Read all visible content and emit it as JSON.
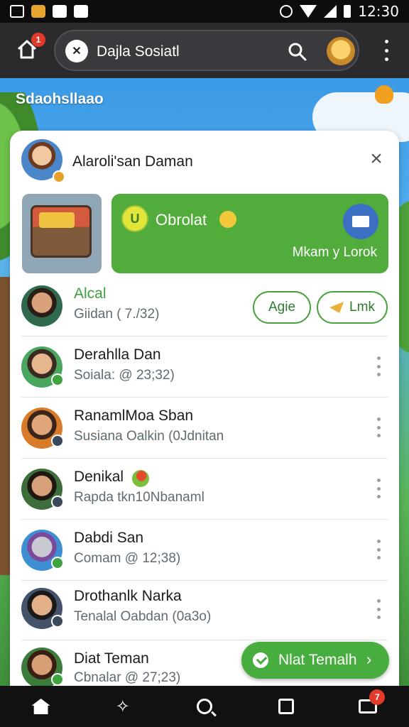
{
  "status_bar": {
    "time": "12:30"
  },
  "header": {
    "home_badge": "1",
    "app_title": "Dajla Sosiatl",
    "app_logo_glyph": "✕"
  },
  "scene": {
    "title": "Sdaohsllaao"
  },
  "card": {
    "header_name": "Alaroli'san Daman",
    "close_glyph": "×",
    "promo": {
      "emoji_glyph": "U",
      "title": "Obrolat",
      "subtitle": "Mkam y Lorok"
    },
    "rows": [
      {
        "name": "Alcal",
        "sub": "Giidan ( 7./32)",
        "btn1": "Agie",
        "btn2": "Lmk"
      },
      {
        "name": "Derahlla Dan",
        "sub": "Soiala: @ 23;32)"
      },
      {
        "name": "RanamlMoa Sban",
        "sub": "Susiana Oalkin (0Jdnitan"
      },
      {
        "name": "Denikal",
        "sub": "Rapda tkn10Nbanaml"
      },
      {
        "name": "Dabdi San",
        "sub": "Comam @ 12;38)"
      },
      {
        "name": "Drothanlk Narka",
        "sub": "Tenalal Oabdan (0a3o)"
      },
      {
        "name": "Diat Teman",
        "sub": "Cbnalar @ 27;23)"
      }
    ],
    "next_button": {
      "label": "Nlat Temalh",
      "chevron": "›"
    }
  },
  "bottom_nav": {
    "badge": "7",
    "spark_glyph": "✧"
  },
  "colors": {
    "accent_green": "#52ac3c",
    "header_dark": "#2b2b2e",
    "badge_red": "#e23a2b"
  },
  "icons": [
    "home-icon",
    "search-icon",
    "more-vert-icon",
    "close-icon",
    "mail-icon",
    "square-icon",
    "stack-icon"
  ]
}
